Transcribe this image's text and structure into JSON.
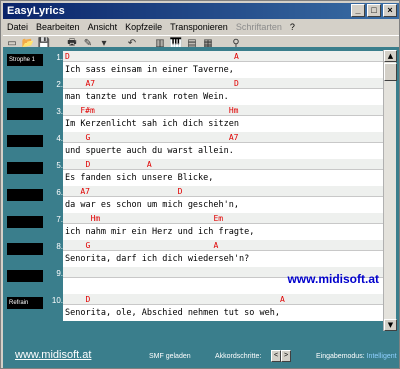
{
  "window": {
    "title": "EasyLyrics",
    "controls": [
      "_",
      "□",
      "×"
    ]
  },
  "menu": [
    {
      "label": "Datei",
      "enabled": true
    },
    {
      "label": "Bearbeiten",
      "enabled": true
    },
    {
      "label": "Ansicht",
      "enabled": true
    },
    {
      "label": "Kopfzeile",
      "enabled": true
    },
    {
      "label": "Transponieren",
      "enabled": true
    },
    {
      "label": "Schriftarten",
      "enabled": false
    },
    {
      "label": "?",
      "enabled": true
    }
  ],
  "toolbar": [
    {
      "name": "new-file-icon",
      "glyph": "▭"
    },
    {
      "name": "open-folder-icon",
      "glyph": "📂"
    },
    {
      "name": "save-icon",
      "glyph": "💾"
    },
    {
      "name": "print-icon",
      "glyph": "🖶"
    },
    {
      "name": "highlight-icon",
      "glyph": "✎"
    },
    {
      "name": "arrow-dropdown-icon",
      "glyph": "▾"
    },
    {
      "name": "undo-icon",
      "glyph": "↶"
    },
    {
      "name": "bars-icon",
      "glyph": "▥"
    },
    {
      "name": "piano-icon",
      "glyph": "🎹"
    },
    {
      "name": "chart-icon",
      "glyph": "▤"
    },
    {
      "name": "export-icon",
      "glyph": "▦"
    },
    {
      "name": "search-icon",
      "glyph": "⚲"
    }
  ],
  "rows": [
    {
      "num": "1.",
      "label": "Strophe 1",
      "chords": [
        {
          "text": "D",
          "col": 0
        },
        {
          "text": "A",
          "col": 33
        }
      ],
      "lyric": "Ich sass einsam in einer Taverne,"
    },
    {
      "num": "2.",
      "label": "",
      "chords": [
        {
          "text": "A7",
          "col": 4
        },
        {
          "text": "D",
          "col": 33
        }
      ],
      "lyric": "man tanzte und trank roten Wein."
    },
    {
      "num": "3.",
      "label": "",
      "chords": [
        {
          "text": "F#m",
          "col": 3
        },
        {
          "text": "Hm",
          "col": 32
        }
      ],
      "lyric": "Im Kerzenlicht sah ich dich sitzen"
    },
    {
      "num": "4.",
      "label": "",
      "chords": [
        {
          "text": "G",
          "col": 4
        },
        {
          "text": "A7",
          "col": 32
        }
      ],
      "lyric": "und spuerte auch du warst allein."
    },
    {
      "num": "5.",
      "label": "",
      "chords": [
        {
          "text": "D",
          "col": 4
        },
        {
          "text": "A",
          "col": 16
        }
      ],
      "lyric": "Es fanden sich unsere Blicke,"
    },
    {
      "num": "6.",
      "label": "",
      "chords": [
        {
          "text": "A7",
          "col": 3
        },
        {
          "text": "D",
          "col": 22
        }
      ],
      "lyric": "da war es schon um mich gescheh'n,"
    },
    {
      "num": "7.",
      "label": "",
      "chords": [
        {
          "text": "Hm",
          "col": 5
        },
        {
          "text": "Em",
          "col": 29
        }
      ],
      "lyric": "ich nahm mir ein Herz und ich fragte,"
    },
    {
      "num": "8.",
      "label": "",
      "chords": [
        {
          "text": "G",
          "col": 4
        },
        {
          "text": "A",
          "col": 29
        }
      ],
      "lyric": "Senorita, darf ich dich wiederseh'n?"
    },
    {
      "num": "9.",
      "label": "",
      "chords": [],
      "lyric": "",
      "url": "www.midisoft.at"
    },
    {
      "num": "10.",
      "label": "Refrain",
      "chords": [
        {
          "text": "D",
          "col": 4
        },
        {
          "text": "A",
          "col": 42
        }
      ],
      "lyric": "Senorita, ole, Abschied nehmen tut so weh,"
    }
  ],
  "scrollbar": {
    "up": "▲",
    "down": "▼"
  },
  "status": {
    "url": "www.midisoft.at",
    "smf": "SMF geladen",
    "akkord": "Akkordschritte:",
    "akkord_btns": [
      "<",
      ">"
    ],
    "mode_label": "Eingabemodus:",
    "mode_value": "Intelligent"
  },
  "colors": {
    "background": "#3a7e8c",
    "chord": "#e00000",
    "title_bar": "#0a246a"
  }
}
